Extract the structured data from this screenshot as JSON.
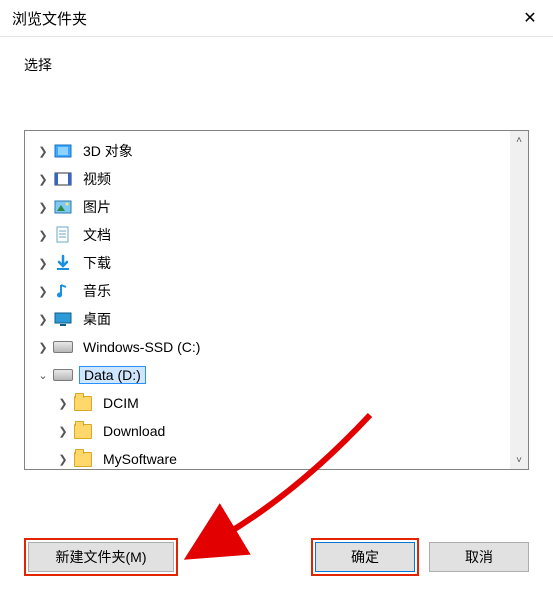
{
  "title": "浏览文件夹",
  "subtitle": "选择",
  "buttons": {
    "new_folder": "新建文件夹(M)",
    "ok": "确定",
    "cancel": "取消"
  },
  "tree": [
    {
      "label": "3D 对象",
      "icon": "3d-icon",
      "depth": 1,
      "expand": "right",
      "selected": false
    },
    {
      "label": "视频",
      "icon": "video-icon",
      "depth": 1,
      "expand": "right",
      "selected": false
    },
    {
      "label": "图片",
      "icon": "picture-icon",
      "depth": 1,
      "expand": "right",
      "selected": false
    },
    {
      "label": "文档",
      "icon": "document-icon",
      "depth": 1,
      "expand": "right",
      "selected": false
    },
    {
      "label": "下载",
      "icon": "download-icon",
      "depth": 1,
      "expand": "right",
      "selected": false
    },
    {
      "label": "音乐",
      "icon": "music-icon",
      "depth": 1,
      "expand": "right",
      "selected": false
    },
    {
      "label": "桌面",
      "icon": "desktop-icon",
      "depth": 1,
      "expand": "right",
      "selected": false
    },
    {
      "label": "Windows-SSD (C:)",
      "icon": "drive-icon",
      "depth": 1,
      "expand": "right",
      "selected": false
    },
    {
      "label": "Data (D:)",
      "icon": "drive-icon",
      "depth": 1,
      "expand": "down",
      "selected": true
    },
    {
      "label": "DCIM",
      "icon": "folder-icon",
      "depth": 2,
      "expand": "right",
      "selected": false
    },
    {
      "label": "Download",
      "icon": "folder-icon",
      "depth": 2,
      "expand": "right",
      "selected": false
    },
    {
      "label": "MySoftware",
      "icon": "folder-icon",
      "depth": 2,
      "expand": "right",
      "selected": false
    }
  ]
}
